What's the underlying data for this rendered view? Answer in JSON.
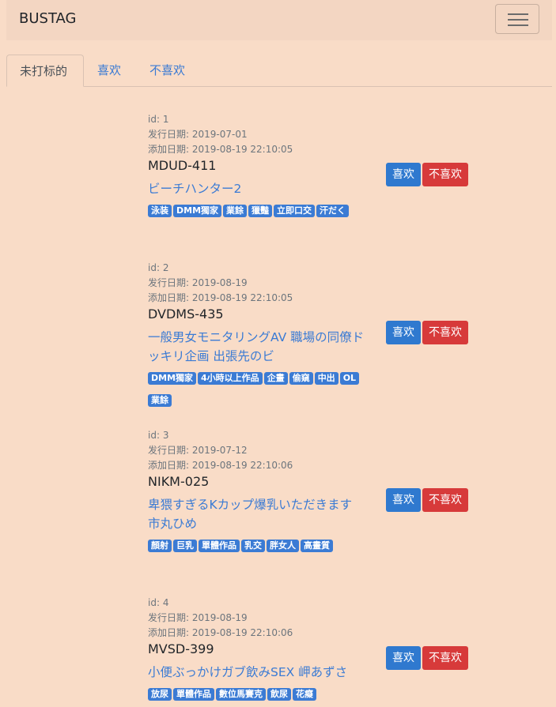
{
  "navbar": {
    "brand": "BUSTAG"
  },
  "tabs": [
    "未打标的",
    "喜欢",
    "不喜欢"
  ],
  "labels": {
    "id": "id: ",
    "release": "发行日期: ",
    "added": "添加日期: ",
    "like": "喜欢",
    "dislike": "不喜欢"
  },
  "items": [
    {
      "id": "1",
      "release": "2019-07-01",
      "added": "2019-08-19 22:10:05",
      "code": "MDUD-411",
      "title": "ビーチハンター2",
      "tags": [
        "泳装",
        "DMM獨家",
        "業餘",
        "獵豔",
        "立即口交",
        "汗だく"
      ]
    },
    {
      "id": "2",
      "release": "2019-08-19",
      "added": "2019-08-19 22:10:05",
      "code": "DVDMS-435",
      "title": "一般男女モニタリングAV 職場の同僚ドッキリ企画 出張先のビ",
      "tags": [
        "DMM獨家",
        "4小時以上作品",
        "企畫",
        "偷窺",
        "中出",
        "OL",
        "業餘"
      ]
    },
    {
      "id": "3",
      "release": "2019-07-12",
      "added": "2019-08-19 22:10:06",
      "code": "NIKM-025",
      "title": "卑猥すぎるKカップ爆乳いただきます 市丸ひめ",
      "tags": [
        "顏射",
        "巨乳",
        "單體作品",
        "乳交",
        "胖女人",
        "高畫質"
      ]
    },
    {
      "id": "4",
      "release": "2019-08-19",
      "added": "2019-08-19 22:10:06",
      "code": "MVSD-399",
      "title": "小便ぶっかけガブ飲みSEX 岬あずさ",
      "tags": [
        "放尿",
        "單體作品",
        "數位馬賽克",
        "飲尿",
        "花癡"
      ]
    }
  ]
}
